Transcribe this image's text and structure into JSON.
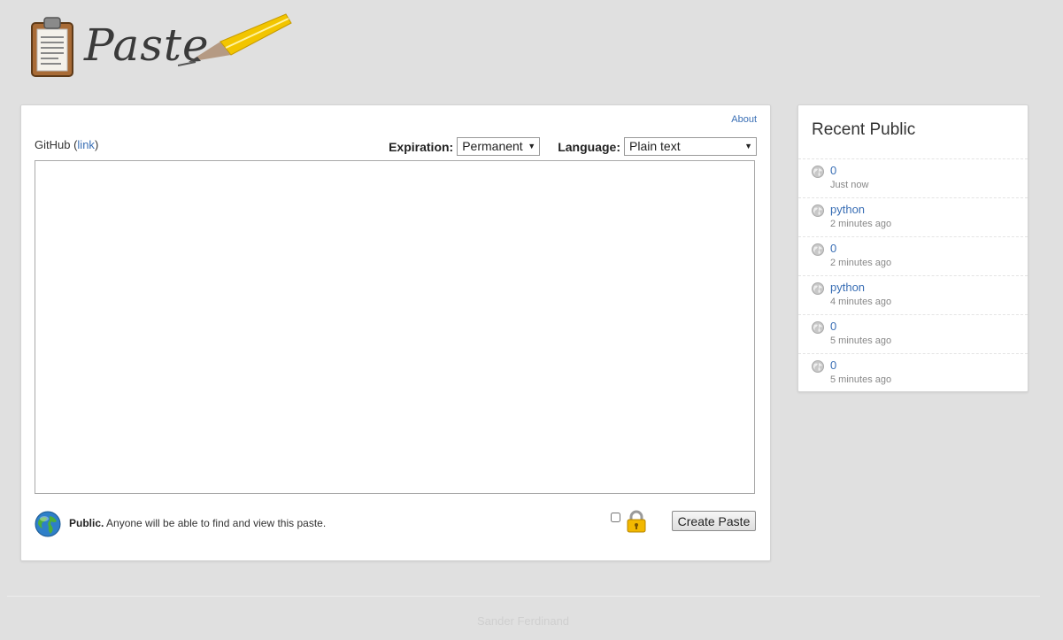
{
  "header": {
    "logo_text": "Paste"
  },
  "main": {
    "about_label": "About",
    "github_label": "GitHub",
    "github_link_label": "link",
    "expiration_label": "Expiration:",
    "expiration_value": "Permanent",
    "language_label": "Language:",
    "language_value": "Plain text",
    "editor_value": "",
    "public_label": "Public.",
    "public_description": "Anyone will be able to find and view this paste.",
    "create_button_label": "Create Paste"
  },
  "sidebar": {
    "title": "Recent Public",
    "items": [
      {
        "label": "0",
        "time": "Just now"
      },
      {
        "label": "python",
        "time": "2 minutes ago"
      },
      {
        "label": "0",
        "time": "2 minutes ago"
      },
      {
        "label": "python",
        "time": "4 minutes ago"
      },
      {
        "label": "0",
        "time": "5 minutes ago"
      },
      {
        "label": "0",
        "time": "5 minutes ago"
      }
    ]
  },
  "footer": {
    "author": "Sander Ferdinand"
  },
  "icons": {
    "logo": "clipboard-icon",
    "pencil": "pencil-icon",
    "public": "globe-icon",
    "private": "lock-icon"
  },
  "colors": {
    "link": "#3a6fb5",
    "background": "#e0e0e0",
    "pencil_yellow": "#f2c500"
  }
}
